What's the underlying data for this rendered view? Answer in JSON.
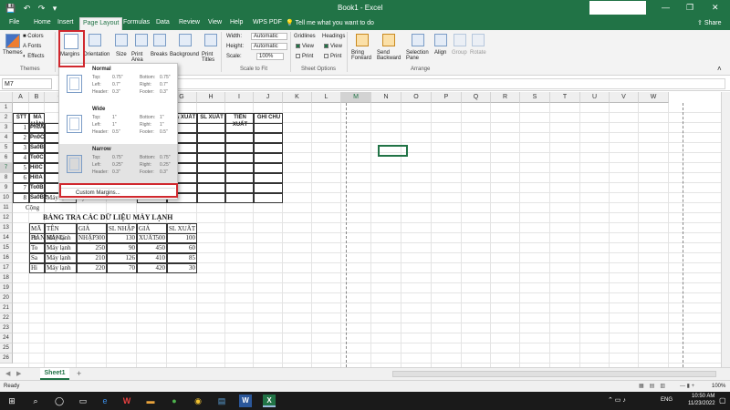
{
  "titlebar": {
    "qat": "💾 ↶ ↷ ▾",
    "title": "Book1 - Excel",
    "minimize": "—",
    "restore": "❐",
    "close": "✕"
  },
  "tabs": [
    "File",
    "Home",
    "Insert",
    "Page Layout",
    "Formulas",
    "Data",
    "Review",
    "View",
    "Help",
    "WPS PDF",
    "Tell me what you want to do"
  ],
  "share": "Share",
  "ribbon": {
    "themes": {
      "themes": "Themes",
      "colors": "Colors",
      "fonts": "Fonts",
      "effects": "Effects",
      "group": "Themes"
    },
    "margins": "Margins",
    "orientation": "Orientation",
    "size": "Size",
    "print_area": "Print Area",
    "breaks": "Breaks",
    "background": "Background",
    "print_titles": "Print Titles",
    "scale": {
      "width": "Width:",
      "width_val": "Automatic",
      "height": "Height:",
      "height_val": "Automatic",
      "scale": "Scale:",
      "scale_val": "100%",
      "group": "Scale to Fit"
    },
    "sheet_options": {
      "gridlines": "Gridlines",
      "headings": "Headings",
      "view": "View",
      "print": "Print",
      "group": "Sheet Options"
    },
    "arrange": {
      "bring_forward": "Bring Forward",
      "send_backward": "Send Backward",
      "selection_pane": "Selection Pane",
      "align": "Align",
      "group_btn": "Group",
      "rotate": "Rotate",
      "group": "Arrange"
    }
  },
  "formula": {
    "namebox": "M7",
    "fx": "fx",
    "value": ""
  },
  "columns": [
    "A",
    "B",
    "C",
    "D",
    "E",
    "F",
    "G",
    "H",
    "I",
    "J",
    "K",
    "L",
    "M",
    "N",
    "O",
    "P",
    "Q",
    "R",
    "S",
    "T",
    "U",
    "V",
    "W"
  ],
  "rows": [
    "1",
    "2",
    "3",
    "4",
    "5",
    "6",
    "7",
    "8",
    "9",
    "10",
    "11",
    "12",
    "13",
    "14",
    "15",
    "16",
    "17",
    "18",
    "19",
    "20",
    "21",
    "22",
    "23",
    "24",
    "25",
    "26"
  ],
  "table1": {
    "headers": {
      "stt": "STT",
      "ma_hang": "MÃ HÀNG",
      "tien_nhap": "TIỀN NHẬP",
      "gia_xuat": "GIÁ XUẤT",
      "sl_xuat": "SL XUẤT",
      "tien_xuat": "TIỀN XUẤT",
      "ghi_chu": "GHI CHÚ"
    },
    "rows": [
      {
        "stt": "1",
        "ma": "Pn0A"
      },
      {
        "stt": "2",
        "ma": "Pn0C"
      },
      {
        "stt": "3",
        "ma": "Sa0B"
      },
      {
        "stt": "4",
        "ma": "To0C"
      },
      {
        "stt": "5",
        "ma": "Hi0C"
      },
      {
        "stt": "6",
        "ma": "Hi0A"
      },
      {
        "stt": "7",
        "ma": "To0B"
      },
      {
        "stt": "8",
        "ma": "Sa0B2",
        "ten": "Máy lạnh Sanyo"
      }
    ],
    "total": "Cộng"
  },
  "table2": {
    "title": "BẢNG TRA CÁC DỮ LIỆU MÁY LẠNH",
    "headers": [
      "MÃ HÀNG",
      "TÊN HÀNG",
      "GIÁ NHẬP",
      "SL NHẬP",
      "GIÁ XUẤT",
      "SL XUẤT"
    ],
    "rows": [
      [
        "Pn",
        "Máy lạnh",
        "300",
        "130",
        "500",
        "100"
      ],
      [
        "To",
        "Máy lạnh",
        "250",
        "90",
        "450",
        "60"
      ],
      [
        "Sa",
        "Máy lạnh",
        "210",
        "126",
        "410",
        "85"
      ],
      [
        "Hi",
        "Máy lạnh",
        "220",
        "70",
        "420",
        "30"
      ]
    ]
  },
  "margins_menu": {
    "normal": {
      "name": "Normal",
      "top": "Top:",
      "top_v": "0.75\"",
      "bottom": "Bottom:",
      "bottom_v": "0.75\"",
      "left": "Left:",
      "left_v": "0.7\"",
      "right": "Right:",
      "right_v": "0.7\"",
      "header": "Header:",
      "header_v": "0.3\"",
      "footer": "Footer:",
      "footer_v": "0.3\""
    },
    "wide": {
      "name": "Wide",
      "top": "Top:",
      "top_v": "1\"",
      "bottom": "Bottom:",
      "bottom_v": "1\"",
      "left": "Left:",
      "left_v": "1\"",
      "right": "Right:",
      "right_v": "1\"",
      "header": "Header:",
      "header_v": "0.5\"",
      "footer": "Footer:",
      "footer_v": "0.5\""
    },
    "narrow": {
      "name": "Narrow",
      "top": "Top:",
      "top_v": "0.75\"",
      "bottom": "Bottom:",
      "bottom_v": "0.75\"",
      "left": "Left:",
      "left_v": "0.25\"",
      "right": "Right:",
      "right_v": "0.25\"",
      "header": "Header:",
      "header_v": "0.3\"",
      "footer": "Footer:",
      "footer_v": "0.3\""
    },
    "custom": "Custom Margins..."
  },
  "sheet": {
    "tab": "Sheet1",
    "add": "+"
  },
  "status": {
    "ready": "Ready",
    "zoom": "100%"
  },
  "taskbar": {
    "lang": "ENG",
    "time": "10:50 AM",
    "date": "11/23/2022"
  },
  "colors": {
    "excel_green": "#217346",
    "highlight_red": "#d0282e"
  }
}
